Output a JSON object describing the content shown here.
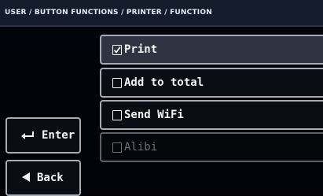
{
  "header": {
    "breadcrumb": "USER / BUTTON FUNCTIONS / PRINTER / FUNCTION"
  },
  "options": [
    {
      "label": "Print",
      "checked": true,
      "state": "selected"
    },
    {
      "label": "Add to total",
      "checked": false,
      "state": "normal"
    },
    {
      "label": "Send WiFi",
      "checked": false,
      "state": "normal"
    },
    {
      "label": "Alibi",
      "checked": false,
      "state": "disabled"
    }
  ],
  "buttons": {
    "enter": {
      "label": "Enter",
      "icon": "enter-return-arrow-icon"
    },
    "back": {
      "label": "Back",
      "icon": "back-triangle-icon"
    }
  },
  "colors": {
    "background": "#02040a",
    "header": "#141c2c",
    "selected_row": "#2e3442",
    "border": "#a6acb6",
    "disabled_text": "#6a6f78",
    "text": "#f4f6f8"
  }
}
